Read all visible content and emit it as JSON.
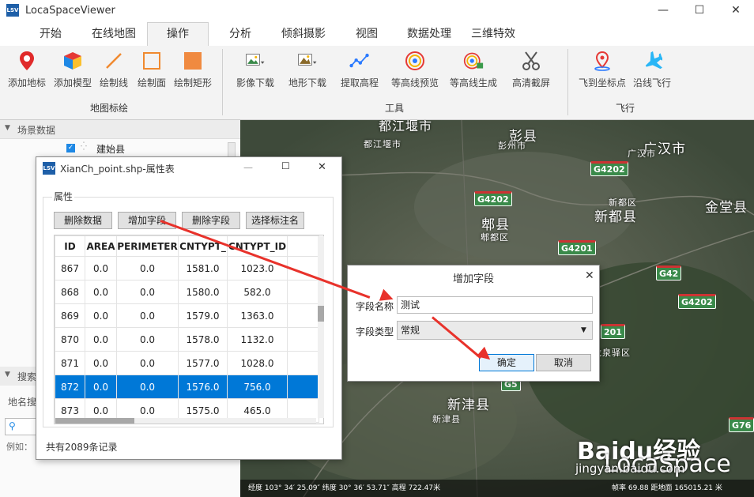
{
  "window": {
    "title": "LocaSpaceViewer",
    "minimize": "—",
    "maximize": "☐",
    "close": "✕"
  },
  "menu": [
    "开始",
    "在线地图",
    "操作",
    "分析",
    "倾斜摄影",
    "视图",
    "数据处理",
    "三维特效"
  ],
  "ribbon": {
    "groups": [
      {
        "label": "地图标绘",
        "items": [
          "添加地标",
          "添加模型",
          "绘制线",
          "绘制面",
          "绘制矩形"
        ]
      },
      {
        "label": "工具",
        "items": [
          "影像下载",
          "地形下载",
          "提取高程",
          "等高线预览",
          "等高线生成",
          "高清截屏"
        ]
      },
      {
        "label": "飞行",
        "items": [
          "飞到坐标点",
          "沿线飞行"
        ]
      }
    ]
  },
  "left_panel": {
    "scene_header": "场景数据",
    "tree_item": "建始县",
    "search_header": "搜索",
    "search_label": "地名搜",
    "example_label": "例如："
  },
  "attr_window": {
    "title": "XianCh_point.shp-属性表",
    "section": "属性",
    "buttons": [
      "删除数据",
      "增加字段",
      "删除字段",
      "选择标注名"
    ],
    "columns": [
      "ID",
      "AREA",
      "PERIMETER",
      "CNTYPT_",
      "CNTYPT_ID"
    ],
    "rows": [
      [
        "867",
        "0.0",
        "0.0",
        "1581.0",
        "1023.0"
      ],
      [
        "868",
        "0.0",
        "0.0",
        "1580.0",
        "582.0"
      ],
      [
        "869",
        "0.0",
        "0.0",
        "1579.0",
        "1363.0"
      ],
      [
        "870",
        "0.0",
        "0.0",
        "1578.0",
        "1132.0"
      ],
      [
        "871",
        "0.0",
        "0.0",
        "1577.0",
        "1028.0"
      ],
      [
        "872",
        "0.0",
        "0.0",
        "1576.0",
        "756.0"
      ],
      [
        "873",
        "0.0",
        "0.0",
        "1575.0",
        "465.0"
      ]
    ],
    "selected_id": "872",
    "record_count": "共有2089条记录",
    "minimize": "—",
    "maximize": "☐",
    "close": "✕"
  },
  "field_dialog": {
    "title": "增加字段",
    "name_label": "字段名称",
    "name_value": "测试",
    "type_label": "字段类型",
    "type_value": "常规",
    "ok": "确定",
    "cancel": "取消",
    "close": "✕"
  },
  "map": {
    "labels": [
      "都江堰市",
      "都江堰市",
      "彭县",
      "彭州市",
      "广汉市",
      "广汉市",
      "金堂县",
      "新都县",
      "新都区",
      "郫县",
      "郫都区",
      "龙泉驿区",
      "新津县",
      "新津县"
    ],
    "roads": [
      "G4202",
      "G4202",
      "G4201",
      "G42",
      "G4202",
      "G5",
      "201",
      "G76"
    ],
    "status": "经度 103° 34′ 25.09″   纬度 30° 36′ 53.71″   高程 722.47米",
    "status_right": "帧率 69.88  距地面 165015.21 米"
  },
  "watermark": {
    "brand": "Baidu经验",
    "site": "jingyan.baidu.com",
    "logo": "LocaSpace"
  },
  "colors": {
    "selected_row": "#0078d7",
    "arrow": "#e8322b",
    "road_sign": "#3a8a4a"
  }
}
